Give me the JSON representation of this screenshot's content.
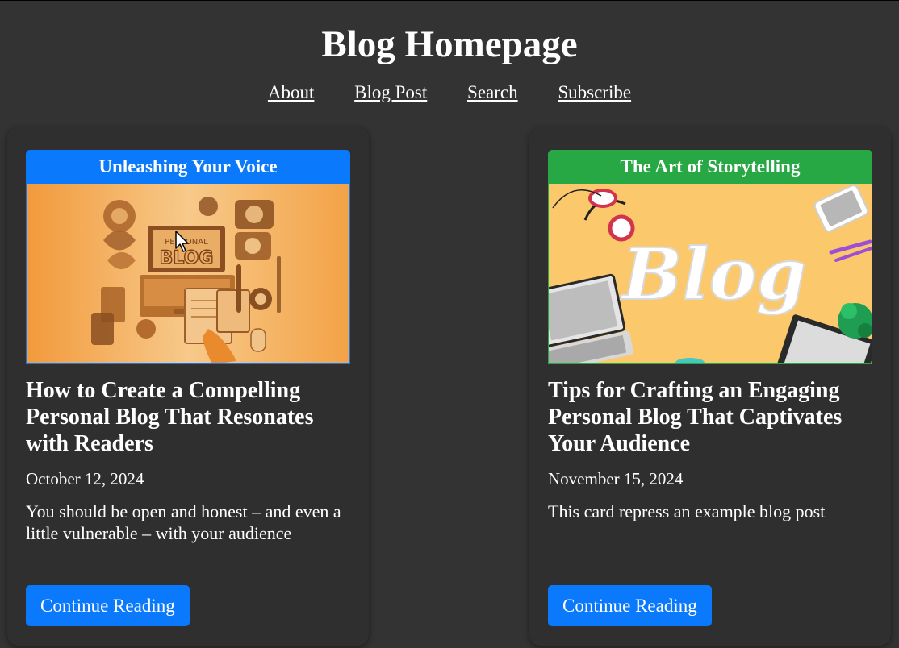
{
  "header": {
    "title": "Blog Homepage",
    "nav": [
      {
        "label": "About"
      },
      {
        "label": "Blog Post"
      },
      {
        "label": "Search"
      },
      {
        "label": "Subscribe"
      }
    ]
  },
  "cards": [
    {
      "banner": "Unleashing Your Voice",
      "banner_color": "#0a79fb",
      "image_text": "PERSONAL BLOG",
      "title": "How to Create a Compelling Personal Blog That Resonates with Readers",
      "date": "October 12, 2024",
      "excerpt": "You should be open and honest – and even a little vulnerable – with your audience",
      "button": "Continue Reading"
    },
    {
      "banner": "The Art of Storytelling",
      "banner_color": "#28a745",
      "image_text": "Blog",
      "title": "Tips for Crafting an Engaging Personal Blog That Captivates Your Audience",
      "date": "November 15, 2024",
      "excerpt": "This card repress an example blog post",
      "button": "Continue Reading"
    }
  ],
  "colors": {
    "background": "#333333",
    "card": "#2f2f2f",
    "button": "#0a79fb"
  }
}
